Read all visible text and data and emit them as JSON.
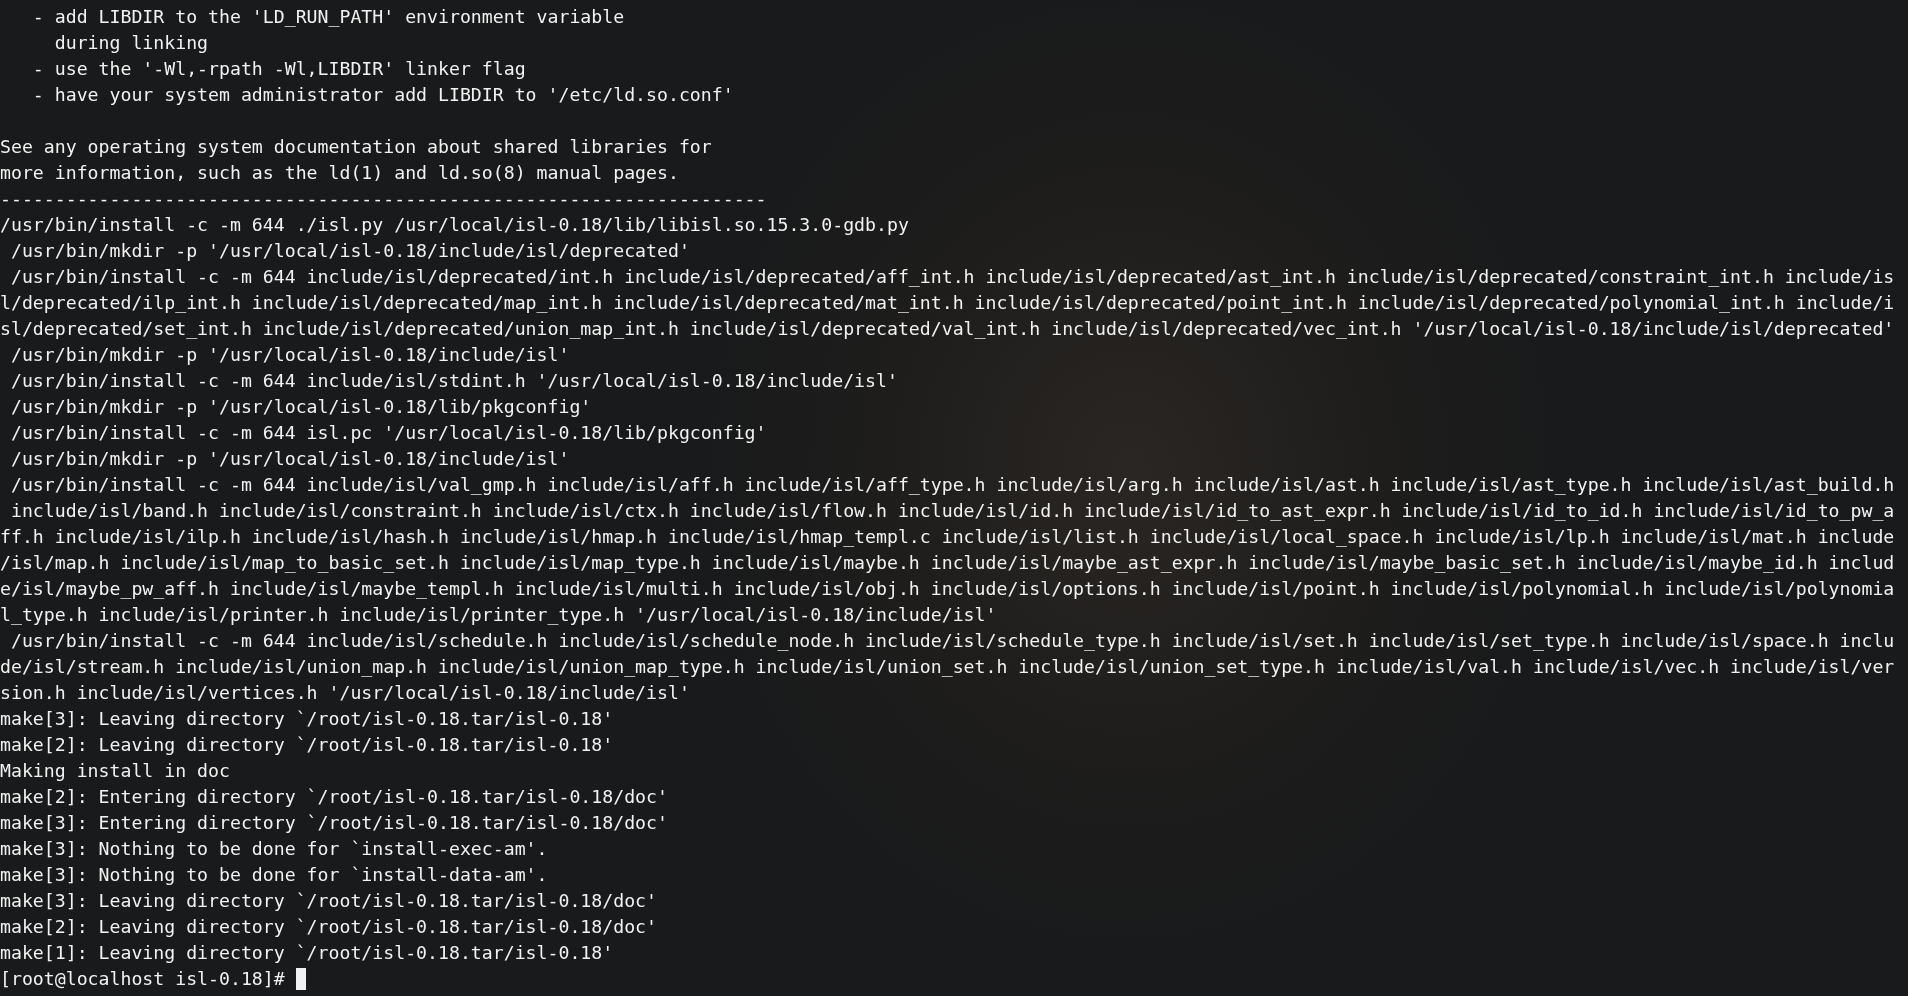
{
  "terminal": {
    "blocks": [
      [
        "   - add LIBDIR to the 'LD_RUN_PATH' environment variable",
        "     during linking",
        "   - use the '-Wl,-rpath -Wl,LIBDIR' linker flag",
        "   - have your system administrator add LIBDIR to '/etc/ld.so.conf'"
      ],
      [
        "See any operating system documentation about shared libraries for",
        "more information, such as the ld(1) and ld.so(8) manual pages.",
        "----------------------------------------------------------------------",
        "/usr/bin/install -c -m 644 ./isl.py /usr/local/isl-0.18/lib/libisl.so.15.3.0-gdb.py",
        " /usr/bin/mkdir -p '/usr/local/isl-0.18/include/isl/deprecated'",
        " /usr/bin/install -c -m 644 include/isl/deprecated/int.h include/isl/deprecated/aff_int.h include/isl/deprecated/ast_int.h include/isl/deprecated/constraint_int.h include/is",
        "l/deprecated/ilp_int.h include/isl/deprecated/map_int.h include/isl/deprecated/mat_int.h include/isl/deprecated/point_int.h include/isl/deprecated/polynomial_int.h include/i",
        "sl/deprecated/set_int.h include/isl/deprecated/union_map_int.h include/isl/deprecated/val_int.h include/isl/deprecated/vec_int.h '/usr/local/isl-0.18/include/isl/deprecated'",
        " /usr/bin/mkdir -p '/usr/local/isl-0.18/include/isl'",
        " /usr/bin/install -c -m 644 include/isl/stdint.h '/usr/local/isl-0.18/include/isl'",
        " /usr/bin/mkdir -p '/usr/local/isl-0.18/lib/pkgconfig'",
        " /usr/bin/install -c -m 644 isl.pc '/usr/local/isl-0.18/lib/pkgconfig'",
        " /usr/bin/mkdir -p '/usr/local/isl-0.18/include/isl'",
        " /usr/bin/install -c -m 644 include/isl/val_gmp.h include/isl/aff.h include/isl/aff_type.h include/isl/arg.h include/isl/ast.h include/isl/ast_type.h include/isl/ast_build.h",
        " include/isl/band.h include/isl/constraint.h include/isl/ctx.h include/isl/flow.h include/isl/id.h include/isl/id_to_ast_expr.h include/isl/id_to_id.h include/isl/id_to_pw_a",
        "ff.h include/isl/ilp.h include/isl/hash.h include/isl/hmap.h include/isl/hmap_templ.c include/isl/list.h include/isl/local_space.h include/isl/lp.h include/isl/mat.h include",
        "/isl/map.h include/isl/map_to_basic_set.h include/isl/map_type.h include/isl/maybe.h include/isl/maybe_ast_expr.h include/isl/maybe_basic_set.h include/isl/maybe_id.h includ",
        "e/isl/maybe_pw_aff.h include/isl/maybe_templ.h include/isl/multi.h include/isl/obj.h include/isl/options.h include/isl/point.h include/isl/polynomial.h include/isl/polynomia",
        "l_type.h include/isl/printer.h include/isl/printer_type.h '/usr/local/isl-0.18/include/isl'",
        " /usr/bin/install -c -m 644 include/isl/schedule.h include/isl/schedule_node.h include/isl/schedule_type.h include/isl/set.h include/isl/set_type.h include/isl/space.h inclu",
        "de/isl/stream.h include/isl/union_map.h include/isl/union_map_type.h include/isl/union_set.h include/isl/union_set_type.h include/isl/val.h include/isl/vec.h include/isl/ver",
        "sion.h include/isl/vertices.h '/usr/local/isl-0.18/include/isl'",
        "make[3]: Leaving directory `/root/isl-0.18.tar/isl-0.18'",
        "make[2]: Leaving directory `/root/isl-0.18.tar/isl-0.18'",
        "Making install in doc",
        "make[2]: Entering directory `/root/isl-0.18.tar/isl-0.18/doc'",
        "make[3]: Entering directory `/root/isl-0.18.tar/isl-0.18/doc'",
        "make[3]: Nothing to be done for `install-exec-am'.",
        "make[3]: Nothing to be done for `install-data-am'.",
        "make[3]: Leaving directory `/root/isl-0.18.tar/isl-0.18/doc'",
        "make[2]: Leaving directory `/root/isl-0.18.tar/isl-0.18/doc'",
        "make[1]: Leaving directory `/root/isl-0.18.tar/isl-0.18'"
      ]
    ],
    "prompt": "[root@localhost isl-0.18]#"
  }
}
